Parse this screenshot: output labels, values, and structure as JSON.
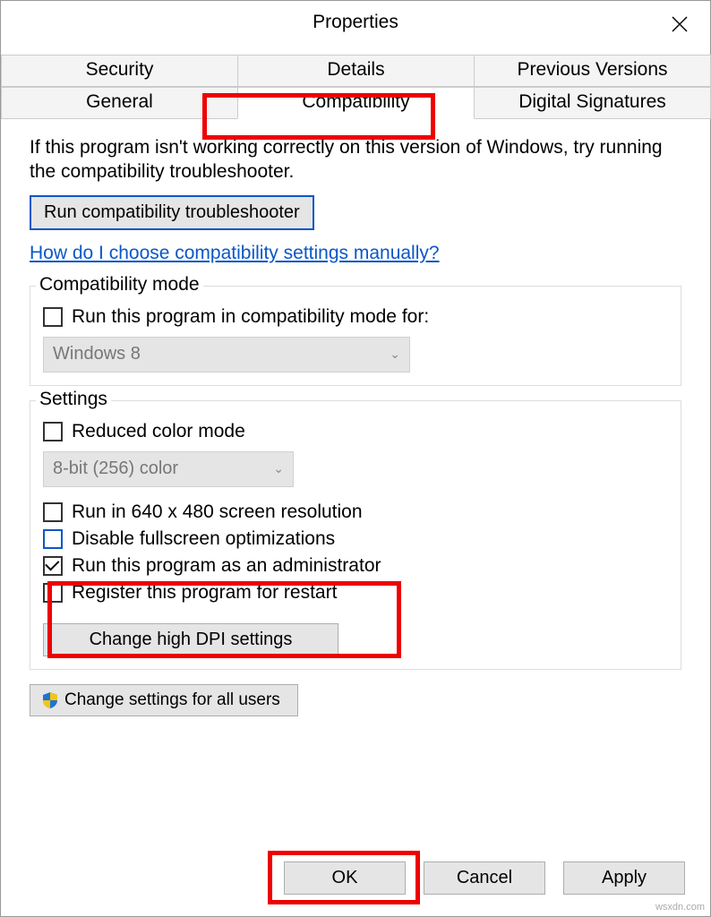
{
  "window": {
    "title": "Properties"
  },
  "tabs": {
    "row1": [
      "Security",
      "Details",
      "Previous Versions"
    ],
    "row2": [
      "General",
      "Compatibility",
      "Digital Signatures"
    ]
  },
  "intro": "If this program isn't working correctly on this version of Windows, try running the compatibility troubleshooter.",
  "troubleshooter_btn": "Run compatibility troubleshooter",
  "manual_link": "How do I choose compatibility settings manually?",
  "compat_mode": {
    "legend": "Compatibility mode",
    "checkbox": "Run this program in compatibility mode for:",
    "combo": "Windows 8"
  },
  "settings": {
    "legend": "Settings",
    "reduced_color": "Reduced color mode",
    "color_combo": "8-bit (256) color",
    "run_640": "Run in 640 x 480 screen resolution",
    "disable_fullscreen": "Disable fullscreen optimizations",
    "run_admin": "Run this program as an administrator",
    "register_restart": "Register this program for restart",
    "dpi_btn": "Change high DPI settings"
  },
  "all_users_btn": "Change settings for all users",
  "buttons": {
    "ok": "OK",
    "cancel": "Cancel",
    "apply": "Apply"
  },
  "watermark": "wsxdn.com"
}
